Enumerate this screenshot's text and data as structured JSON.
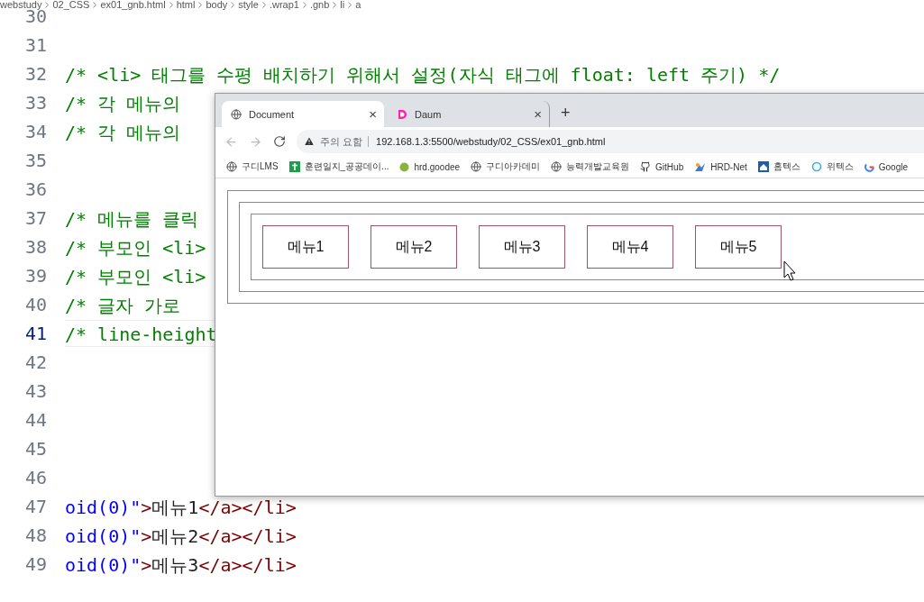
{
  "breadcrumb": [
    "webstudy",
    "02_CSS",
    "ex01_gnb.html",
    "html",
    "body",
    "style",
    ".wrap1",
    ".gnb",
    "li",
    "a"
  ],
  "editor": {
    "lines": [
      {
        "number": "30",
        "current": false
      },
      {
        "number": "31",
        "current": false
      },
      {
        "number": "32",
        "current": false,
        "tokens": [
          {
            "kind": "comment",
            "text": "/* <li> 태그를 수평 배치하기 위해서 설정(자식 태그에 float: left 주기) */"
          }
        ]
      },
      {
        "number": "33",
        "current": false,
        "tokens": [
          {
            "kind": "comment",
            "text": "/* 각 메뉴의"
          }
        ]
      },
      {
        "number": "34",
        "current": false,
        "tokens": [
          {
            "kind": "comment",
            "text": "/* 각 메뉴의"
          }
        ]
      },
      {
        "number": "35",
        "current": false
      },
      {
        "number": "36",
        "current": false
      },
      {
        "number": "37",
        "current": false,
        "tokens": [
          {
            "kind": "comment",
            "text": "/* 메뉴를 클릭"
          }
        ]
      },
      {
        "number": "38",
        "current": false,
        "tokens": [
          {
            "kind": "comment",
            "text": "/* 부모인 <li>"
          }
        ]
      },
      {
        "number": "39",
        "current": false,
        "tokens": [
          {
            "kind": "comment",
            "text": "/* 부모인 <li>"
          }
        ]
      },
      {
        "number": "40",
        "current": false,
        "tokens": [
          {
            "kind": "comment",
            "text": "/* 글자 가로"
          }
        ]
      },
      {
        "number": "41",
        "current": true,
        "tokens": [
          {
            "kind": "comment",
            "text": "/* line-height"
          }
        ]
      },
      {
        "number": "42",
        "current": false
      },
      {
        "number": "43",
        "current": false
      },
      {
        "number": "44",
        "current": false
      },
      {
        "number": "45",
        "current": false
      },
      {
        "number": "46",
        "current": false
      },
      {
        "number": "47",
        "current": false,
        "tokens": [
          {
            "kind": "value",
            "text": "oid(0)\""
          },
          {
            "kind": "tag",
            "text": ">"
          },
          {
            "kind": "plain",
            "text": "메뉴1"
          },
          {
            "kind": "tag",
            "text": "</a></li>"
          }
        ]
      },
      {
        "number": "48",
        "current": false,
        "tokens": [
          {
            "kind": "value",
            "text": "oid(0)\""
          },
          {
            "kind": "tag",
            "text": ">"
          },
          {
            "kind": "plain",
            "text": "메뉴2"
          },
          {
            "kind": "tag",
            "text": "</a></li>"
          }
        ]
      },
      {
        "number": "49",
        "current": false,
        "tokens": [
          {
            "kind": "value",
            "text": "oid(0)\""
          },
          {
            "kind": "tag",
            "text": ">"
          },
          {
            "kind": "plain",
            "text": "메뉴3"
          },
          {
            "kind": "tag",
            "text": "</a></li>"
          }
        ]
      }
    ]
  },
  "browser": {
    "tabs": [
      {
        "title": "Document",
        "selected": true,
        "close": "×"
      },
      {
        "title": "Daum",
        "selected": false,
        "close": "×"
      }
    ],
    "new_tab": "+",
    "address": {
      "warning": "주의 요함",
      "url": "192.168.1.3:5500/webstudy/02_CSS/ex01_gnb.html"
    },
    "bookmarks": [
      "구디LMS",
      "훈련일지_공공데이...",
      "hrd.goodee",
      "구디아카데미",
      "능력개발교육원",
      "GitHub",
      "HRD-Net",
      "홈텍스",
      "위텍스",
      "Google"
    ],
    "menus": [
      "메뉴1",
      "메뉴2",
      "메뉴3",
      "메뉴4",
      "메뉴5"
    ]
  }
}
